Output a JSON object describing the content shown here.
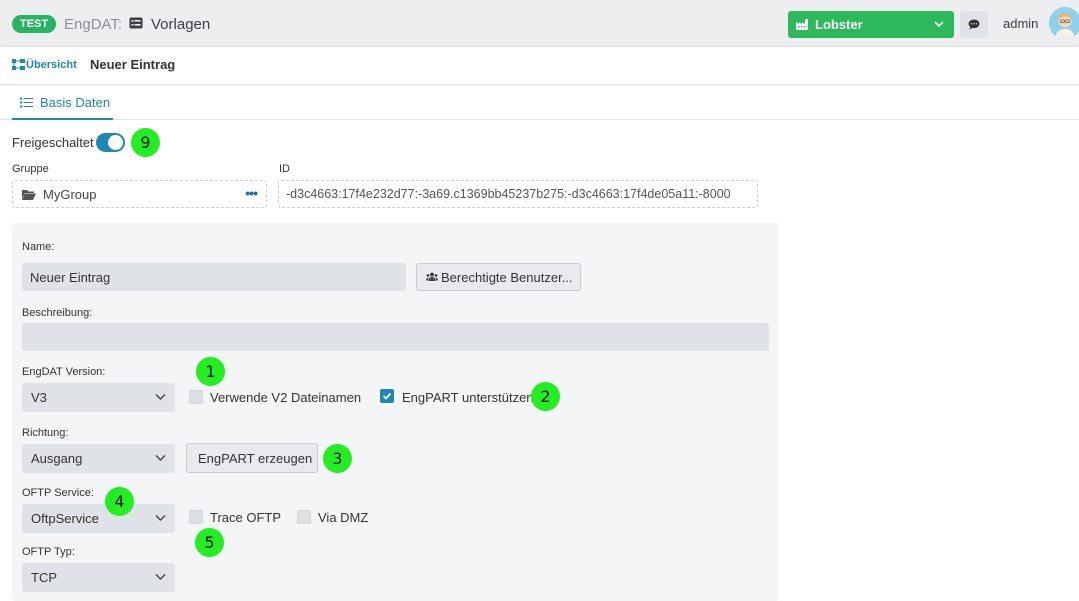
{
  "topbar": {
    "env_badge": "TEST",
    "app_name": "EngDAT:",
    "section_icon": "list-box-icon",
    "section": "Vorlagen",
    "tenant": {
      "icon": "factory-icon",
      "label": "Lobster"
    },
    "message_icon": "chat-bubble-icon",
    "user": "admin"
  },
  "breadcrumb": {
    "icon": "sitemap-icon",
    "link": "Übersicht",
    "current": "Neuer Eintrag"
  },
  "tabs": [
    {
      "icon": "list-icon",
      "label": "Basis Daten"
    }
  ],
  "form": {
    "enabled_label": "Freigeschaltet",
    "enabled": true,
    "group_label": "Gruppe",
    "group_value": "MyGroup",
    "group_more": "•••",
    "id_label": "ID",
    "id_value": "-d3c4663:17f4e232d77:-3a69.c1369bb45237b275:-d3c4663:17f4de05a11:-8000",
    "name_label": "Name:",
    "name_value": "Neuer Eintrag",
    "authorized_users_button": "Berechtigte Benutzer...",
    "description_label": "Beschreibung:",
    "description_value": "",
    "version_label": "EngDAT Version:",
    "version_value": "V3",
    "use_v2_filenames_label": "Verwende V2 Dateinamen",
    "use_v2_filenames": false,
    "engpart_support_label": "EngPART unterstützen",
    "engpart_support": true,
    "direction_label": "Richtung:",
    "direction_value": "Ausgang",
    "engpart_create_button": "EngPART erzeugen",
    "oftp_service_label": "OFTP Service:",
    "oftp_service_value": "OftpService",
    "trace_oftp_label": "Trace OFTP",
    "trace_oftp": false,
    "via_dmz_label": "Via DMZ",
    "via_dmz": false,
    "oftp_type_label": "OFTP Typ:",
    "oftp_type_value": "TCP"
  },
  "markers": [
    "9",
    "1",
    "2",
    "3",
    "4",
    "5"
  ],
  "colors": {
    "accent": "#1e88b0",
    "tenant_green": "#2eb85c",
    "badge_green": "#28b463",
    "marker_green": "#22ee22"
  }
}
